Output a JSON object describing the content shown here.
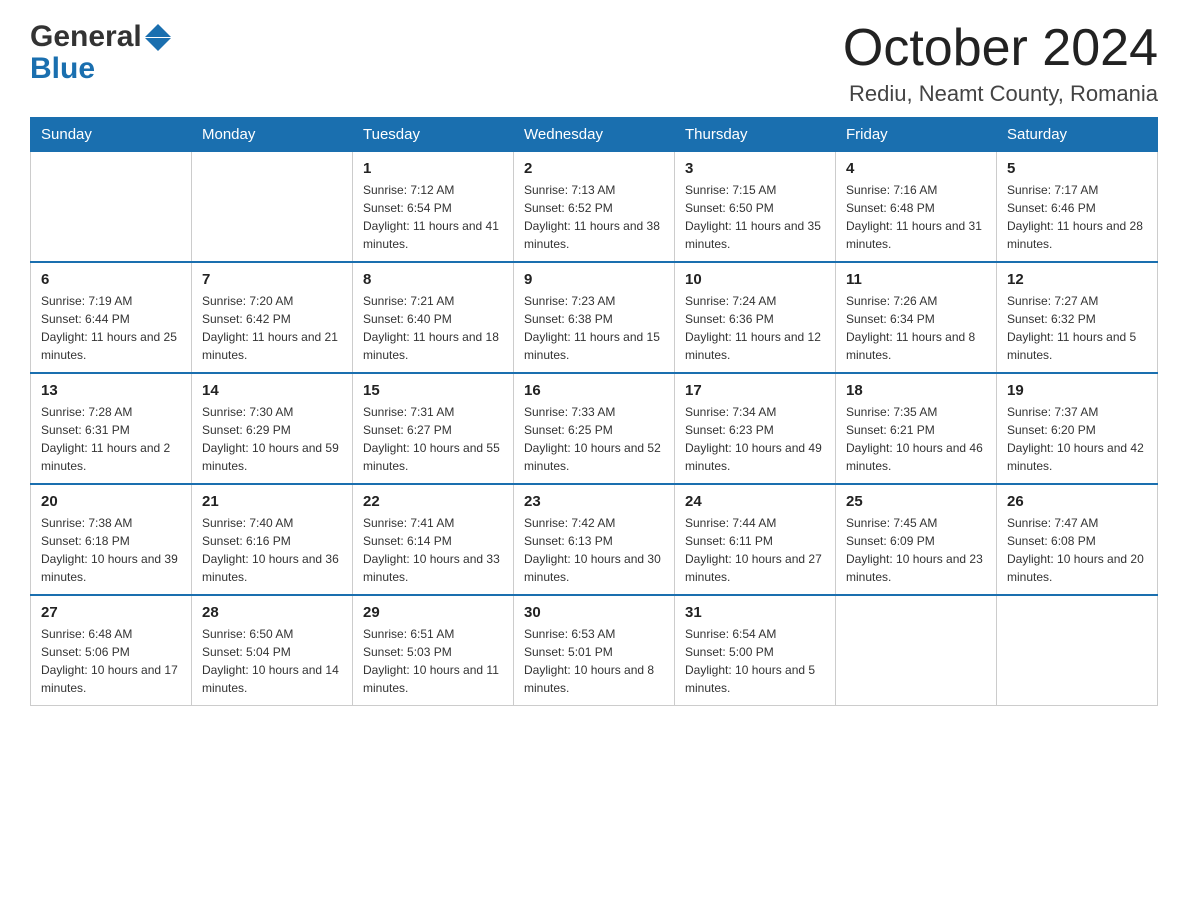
{
  "header": {
    "logo_general": "General",
    "logo_blue": "Blue",
    "month_title": "October 2024",
    "location": "Rediu, Neamt County, Romania"
  },
  "weekdays": [
    "Sunday",
    "Monday",
    "Tuesday",
    "Wednesday",
    "Thursday",
    "Friday",
    "Saturday"
  ],
  "weeks": [
    [
      {
        "day": "",
        "sunrise": "",
        "sunset": "",
        "daylight": ""
      },
      {
        "day": "",
        "sunrise": "",
        "sunset": "",
        "daylight": ""
      },
      {
        "day": "1",
        "sunrise": "Sunrise: 7:12 AM",
        "sunset": "Sunset: 6:54 PM",
        "daylight": "Daylight: 11 hours and 41 minutes."
      },
      {
        "day": "2",
        "sunrise": "Sunrise: 7:13 AM",
        "sunset": "Sunset: 6:52 PM",
        "daylight": "Daylight: 11 hours and 38 minutes."
      },
      {
        "day": "3",
        "sunrise": "Sunrise: 7:15 AM",
        "sunset": "Sunset: 6:50 PM",
        "daylight": "Daylight: 11 hours and 35 minutes."
      },
      {
        "day": "4",
        "sunrise": "Sunrise: 7:16 AM",
        "sunset": "Sunset: 6:48 PM",
        "daylight": "Daylight: 11 hours and 31 minutes."
      },
      {
        "day": "5",
        "sunrise": "Sunrise: 7:17 AM",
        "sunset": "Sunset: 6:46 PM",
        "daylight": "Daylight: 11 hours and 28 minutes."
      }
    ],
    [
      {
        "day": "6",
        "sunrise": "Sunrise: 7:19 AM",
        "sunset": "Sunset: 6:44 PM",
        "daylight": "Daylight: 11 hours and 25 minutes."
      },
      {
        "day": "7",
        "sunrise": "Sunrise: 7:20 AM",
        "sunset": "Sunset: 6:42 PM",
        "daylight": "Daylight: 11 hours and 21 minutes."
      },
      {
        "day": "8",
        "sunrise": "Sunrise: 7:21 AM",
        "sunset": "Sunset: 6:40 PM",
        "daylight": "Daylight: 11 hours and 18 minutes."
      },
      {
        "day": "9",
        "sunrise": "Sunrise: 7:23 AM",
        "sunset": "Sunset: 6:38 PM",
        "daylight": "Daylight: 11 hours and 15 minutes."
      },
      {
        "day": "10",
        "sunrise": "Sunrise: 7:24 AM",
        "sunset": "Sunset: 6:36 PM",
        "daylight": "Daylight: 11 hours and 12 minutes."
      },
      {
        "day": "11",
        "sunrise": "Sunrise: 7:26 AM",
        "sunset": "Sunset: 6:34 PM",
        "daylight": "Daylight: 11 hours and 8 minutes."
      },
      {
        "day": "12",
        "sunrise": "Sunrise: 7:27 AM",
        "sunset": "Sunset: 6:32 PM",
        "daylight": "Daylight: 11 hours and 5 minutes."
      }
    ],
    [
      {
        "day": "13",
        "sunrise": "Sunrise: 7:28 AM",
        "sunset": "Sunset: 6:31 PM",
        "daylight": "Daylight: 11 hours and 2 minutes."
      },
      {
        "day": "14",
        "sunrise": "Sunrise: 7:30 AM",
        "sunset": "Sunset: 6:29 PM",
        "daylight": "Daylight: 10 hours and 59 minutes."
      },
      {
        "day": "15",
        "sunrise": "Sunrise: 7:31 AM",
        "sunset": "Sunset: 6:27 PM",
        "daylight": "Daylight: 10 hours and 55 minutes."
      },
      {
        "day": "16",
        "sunrise": "Sunrise: 7:33 AM",
        "sunset": "Sunset: 6:25 PM",
        "daylight": "Daylight: 10 hours and 52 minutes."
      },
      {
        "day": "17",
        "sunrise": "Sunrise: 7:34 AM",
        "sunset": "Sunset: 6:23 PM",
        "daylight": "Daylight: 10 hours and 49 minutes."
      },
      {
        "day": "18",
        "sunrise": "Sunrise: 7:35 AM",
        "sunset": "Sunset: 6:21 PM",
        "daylight": "Daylight: 10 hours and 46 minutes."
      },
      {
        "day": "19",
        "sunrise": "Sunrise: 7:37 AM",
        "sunset": "Sunset: 6:20 PM",
        "daylight": "Daylight: 10 hours and 42 minutes."
      }
    ],
    [
      {
        "day": "20",
        "sunrise": "Sunrise: 7:38 AM",
        "sunset": "Sunset: 6:18 PM",
        "daylight": "Daylight: 10 hours and 39 minutes."
      },
      {
        "day": "21",
        "sunrise": "Sunrise: 7:40 AM",
        "sunset": "Sunset: 6:16 PM",
        "daylight": "Daylight: 10 hours and 36 minutes."
      },
      {
        "day": "22",
        "sunrise": "Sunrise: 7:41 AM",
        "sunset": "Sunset: 6:14 PM",
        "daylight": "Daylight: 10 hours and 33 minutes."
      },
      {
        "day": "23",
        "sunrise": "Sunrise: 7:42 AM",
        "sunset": "Sunset: 6:13 PM",
        "daylight": "Daylight: 10 hours and 30 minutes."
      },
      {
        "day": "24",
        "sunrise": "Sunrise: 7:44 AM",
        "sunset": "Sunset: 6:11 PM",
        "daylight": "Daylight: 10 hours and 27 minutes."
      },
      {
        "day": "25",
        "sunrise": "Sunrise: 7:45 AM",
        "sunset": "Sunset: 6:09 PM",
        "daylight": "Daylight: 10 hours and 23 minutes."
      },
      {
        "day": "26",
        "sunrise": "Sunrise: 7:47 AM",
        "sunset": "Sunset: 6:08 PM",
        "daylight": "Daylight: 10 hours and 20 minutes."
      }
    ],
    [
      {
        "day": "27",
        "sunrise": "Sunrise: 6:48 AM",
        "sunset": "Sunset: 5:06 PM",
        "daylight": "Daylight: 10 hours and 17 minutes."
      },
      {
        "day": "28",
        "sunrise": "Sunrise: 6:50 AM",
        "sunset": "Sunset: 5:04 PM",
        "daylight": "Daylight: 10 hours and 14 minutes."
      },
      {
        "day": "29",
        "sunrise": "Sunrise: 6:51 AM",
        "sunset": "Sunset: 5:03 PM",
        "daylight": "Daylight: 10 hours and 11 minutes."
      },
      {
        "day": "30",
        "sunrise": "Sunrise: 6:53 AM",
        "sunset": "Sunset: 5:01 PM",
        "daylight": "Daylight: 10 hours and 8 minutes."
      },
      {
        "day": "31",
        "sunrise": "Sunrise: 6:54 AM",
        "sunset": "Sunset: 5:00 PM",
        "daylight": "Daylight: 10 hours and 5 minutes."
      },
      {
        "day": "",
        "sunrise": "",
        "sunset": "",
        "daylight": ""
      },
      {
        "day": "",
        "sunrise": "",
        "sunset": "",
        "daylight": ""
      }
    ]
  ]
}
